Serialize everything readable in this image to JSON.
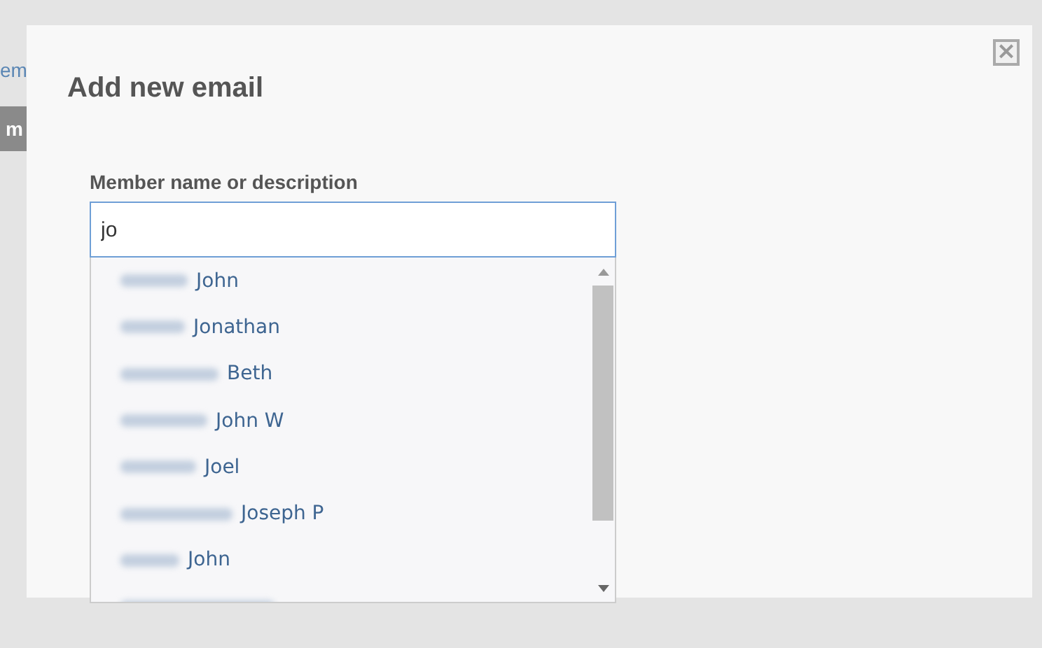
{
  "background": {
    "link_fragment": "em",
    "button_fragment": "m"
  },
  "dialog": {
    "title": "Add new email",
    "close_icon": "×",
    "field": {
      "label": "Member name or description",
      "value": "jo"
    },
    "suggestions": [
      {
        "name": "John"
      },
      {
        "name": "Jonathan"
      },
      {
        "name": "Beth"
      },
      {
        "name": "John W"
      },
      {
        "name": "Joel"
      },
      {
        "name": "Joseph P"
      },
      {
        "name": "John"
      }
    ]
  }
}
